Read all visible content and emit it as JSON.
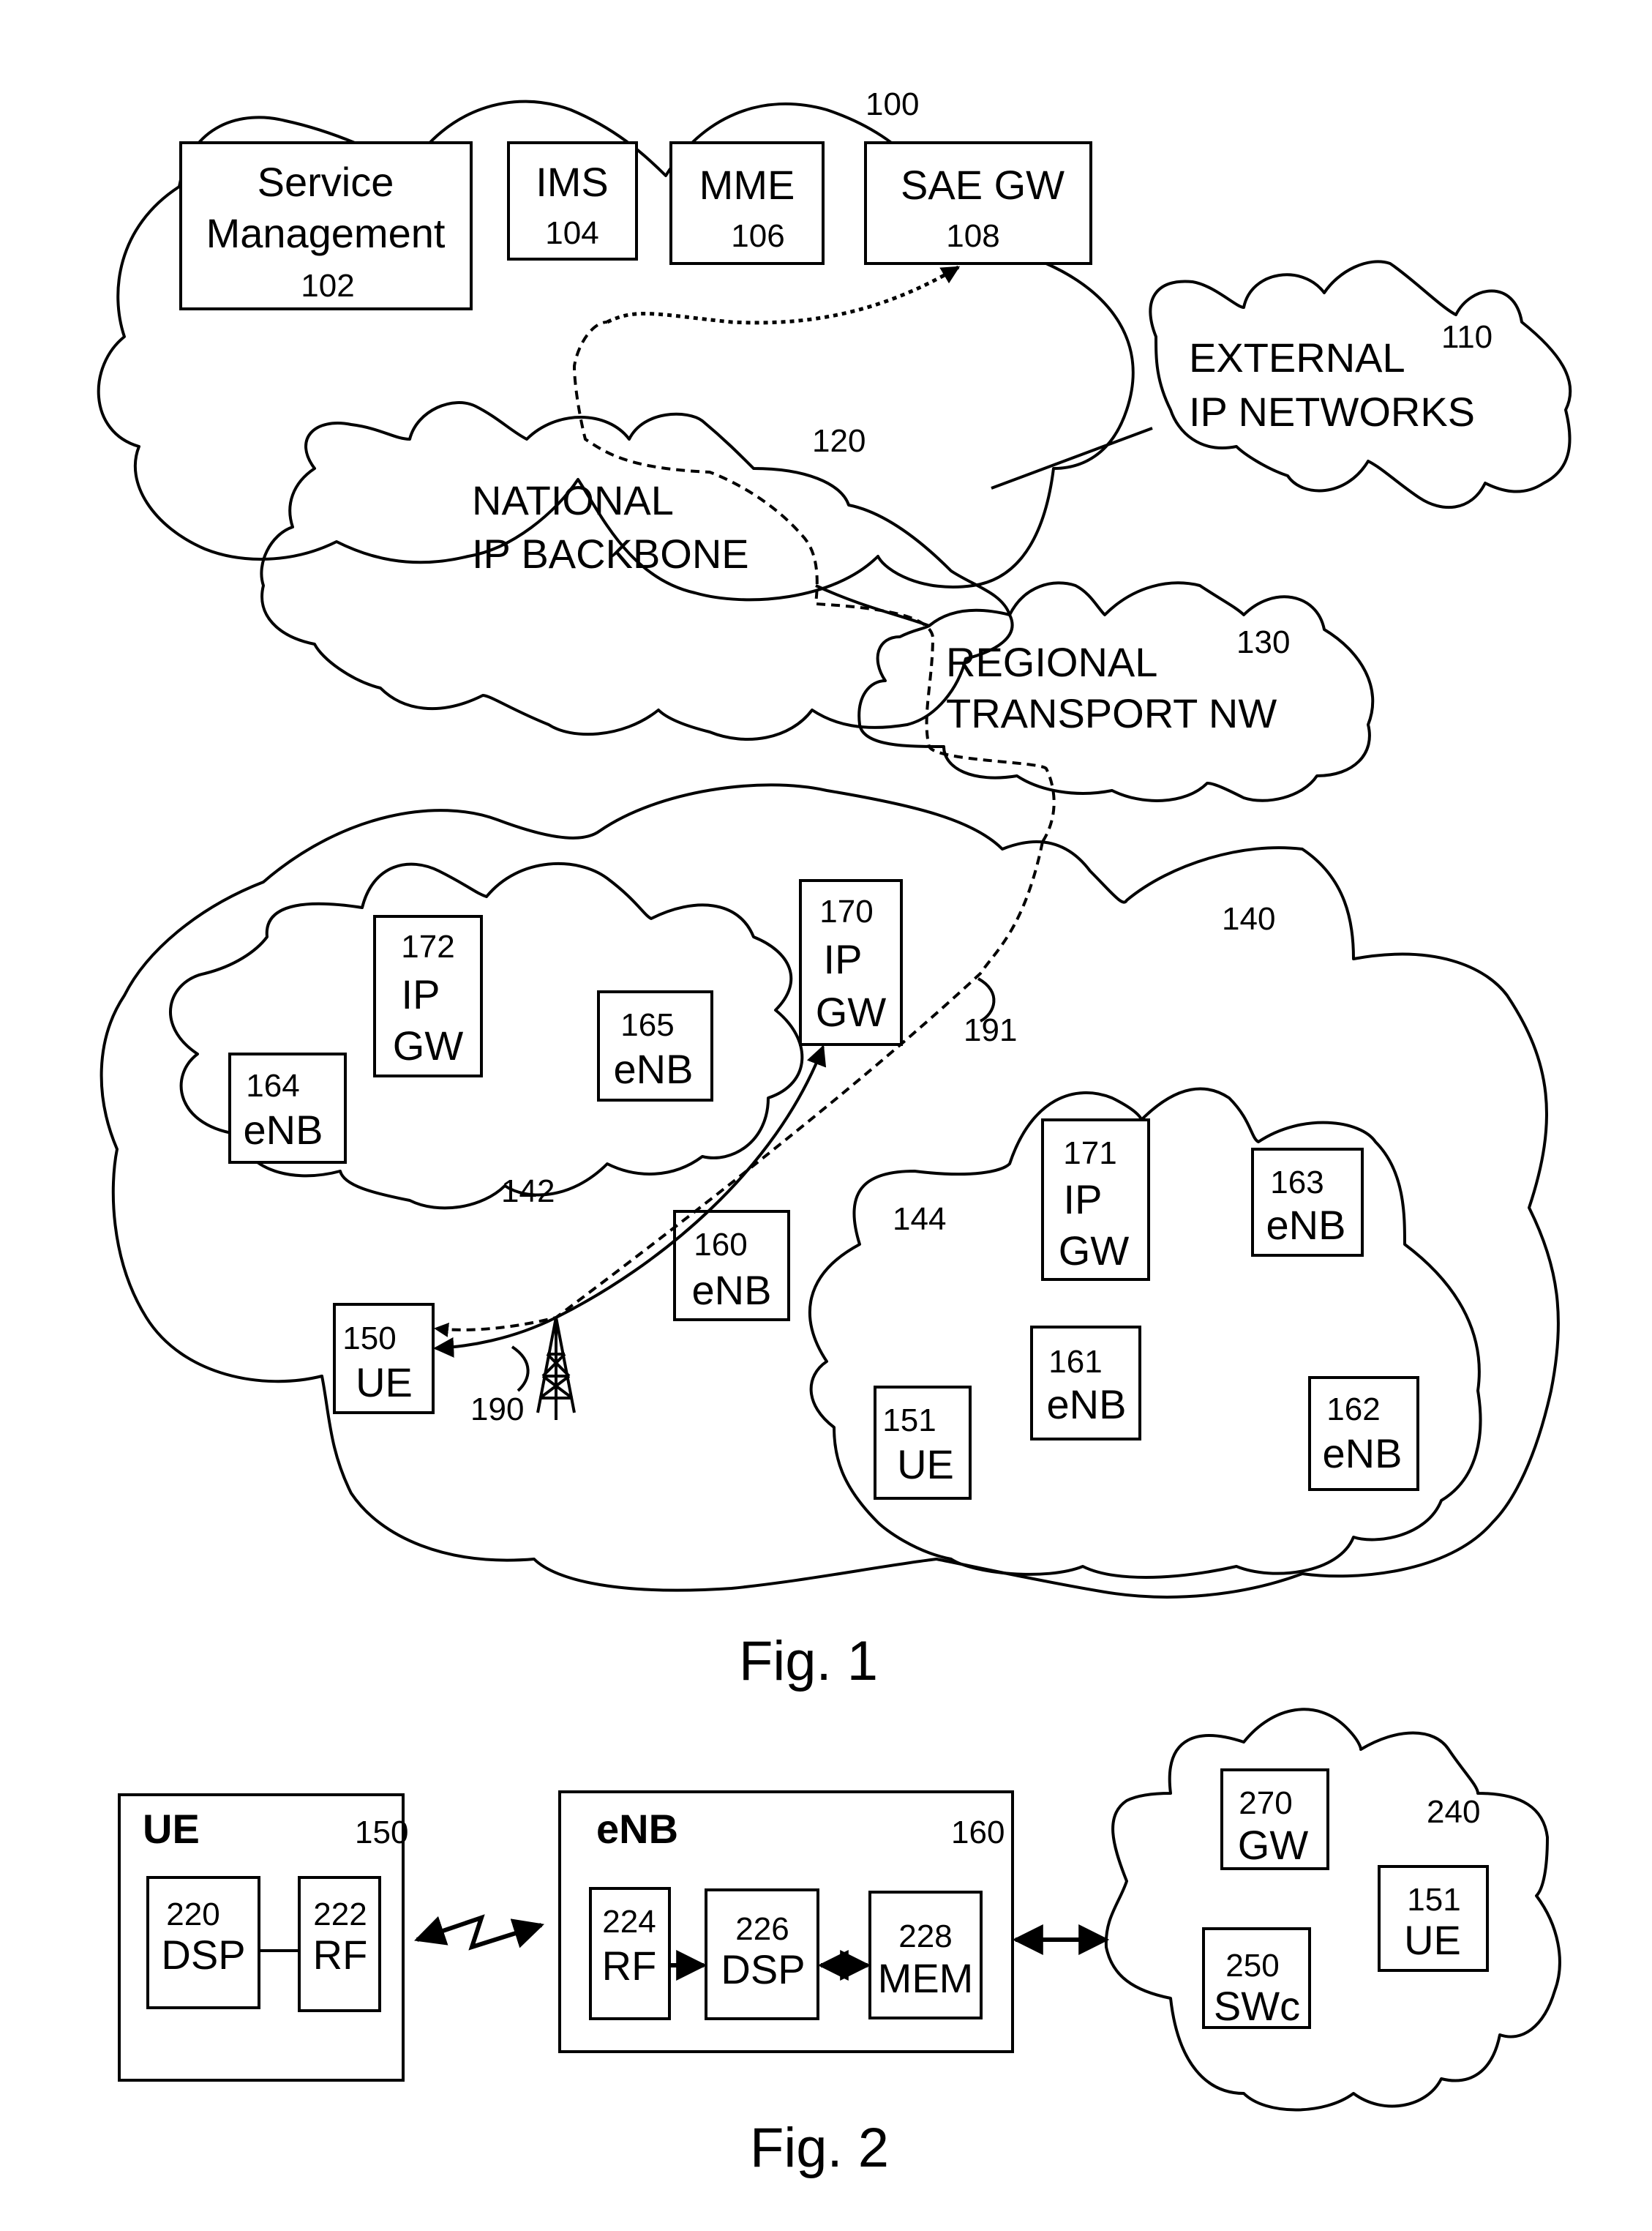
{
  "figure1": {
    "caption": "Fig. 1",
    "core_network": {
      "ref": "100",
      "elements": [
        {
          "line1": "Service",
          "line2": "Management",
          "ref": "102"
        },
        {
          "line1": "IMS",
          "ref": "104"
        },
        {
          "line1": "MME",
          "ref": "106"
        },
        {
          "line1": "SAE GW",
          "ref": "108"
        }
      ]
    },
    "external_networks": {
      "line1": "EXTERNAL",
      "line2": "IP NETWORKS",
      "ref": "110"
    },
    "backbone": {
      "line1": "NATIONAL",
      "line2": "IP BACKBONE",
      "ref": "120"
    },
    "regional": {
      "line1": "REGIONAL",
      "line2": "TRANSPORT NW",
      "ref": "130"
    },
    "access_network": {
      "ref": "140",
      "subnet_142": {
        "ref": "142",
        "ip_gw": {
          "ref": "172",
          "line1": "IP",
          "line2": "GW"
        },
        "enb_165": {
          "ref": "165",
          "label": "eNB"
        },
        "enb_164": {
          "ref": "164",
          "label": "eNB"
        }
      },
      "ip_gw_170": {
        "ref": "170",
        "line1": "IP",
        "line2": "GW"
      },
      "enb_160": {
        "ref": "160",
        "label": "eNB"
      },
      "ue_150": {
        "ref": "150",
        "label": "UE"
      },
      "path_190": "190",
      "path_191": "191",
      "subnet_144": {
        "ref": "144",
        "ip_gw": {
          "ref": "171",
          "line1": "IP",
          "line2": "GW"
        },
        "enb_163": {
          "ref": "163",
          "label": "eNB"
        },
        "enb_161": {
          "ref": "161",
          "label": "eNB"
        },
        "enb_162": {
          "ref": "162",
          "label": "eNB"
        },
        "ue_151": {
          "ref": "151",
          "label": "UE"
        }
      }
    }
  },
  "figure2": {
    "caption": "Fig. 2",
    "ue": {
      "title": "UE",
      "ref": "150",
      "dsp": {
        "ref": "220",
        "label": "DSP"
      },
      "rf": {
        "ref": "222",
        "label": "RF"
      }
    },
    "enb": {
      "title": "eNB",
      "ref": "160",
      "rf": {
        "ref": "224",
        "label": "RF"
      },
      "dsp": {
        "ref": "226",
        "label": "DSP"
      },
      "mem": {
        "ref": "228",
        "label": "MEM"
      }
    },
    "network": {
      "ref": "240",
      "gw": {
        "ref": "270",
        "label": "GW"
      },
      "swc": {
        "ref": "250",
        "label": "SWc"
      },
      "ue": {
        "ref": "151",
        "label": "UE"
      }
    }
  }
}
